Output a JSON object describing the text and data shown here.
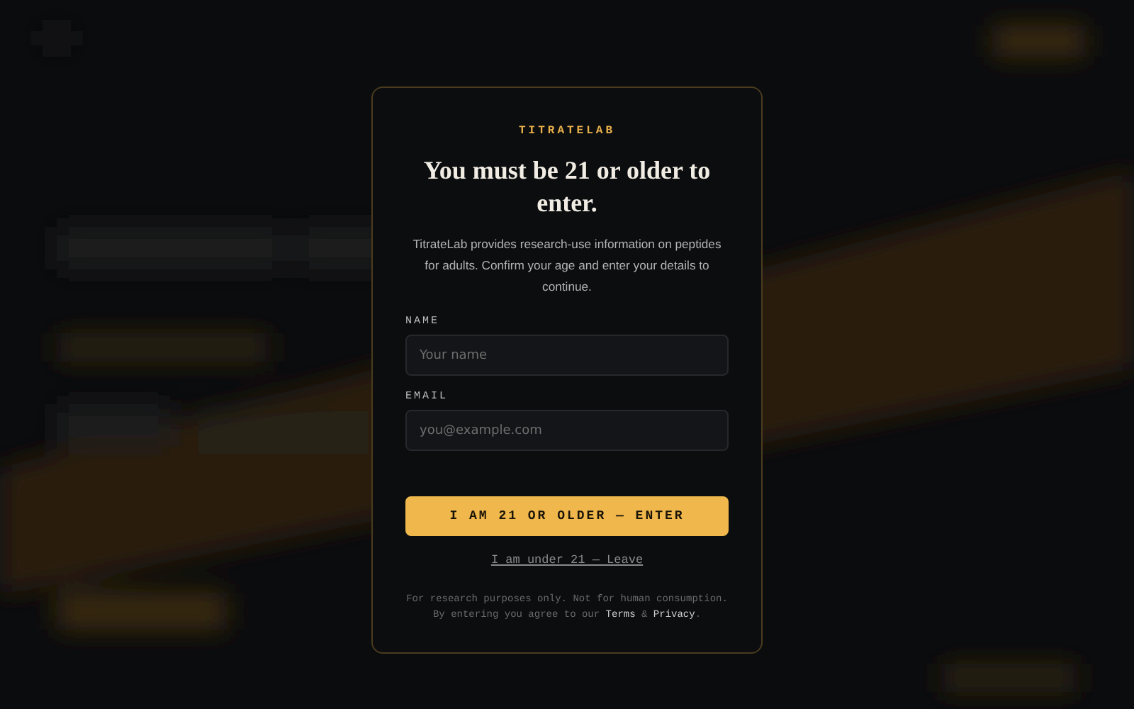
{
  "modal": {
    "brand": "TITRATELAB",
    "title": "You must be 21 or older to enter.",
    "description": "TitrateLab provides research-use information on peptides for adults. Confirm your age and enter your details to continue.",
    "fields": [
      {
        "label": "NAME",
        "placeholder": "Your name"
      },
      {
        "label": "EMAIL",
        "placeholder": "you@example.com"
      }
    ],
    "confirm_button": "I AM 21 OR OLDER — ENTER",
    "leave_link": "I am under 21 — Leave",
    "disclaimer": "For research purposes only. Not for human consumption.",
    "agree_prefix": "By entering you agree to our ",
    "terms_link": "Terms",
    "joiner": " & ",
    "privacy_link": "Privacy",
    "agree_suffix": "."
  }
}
